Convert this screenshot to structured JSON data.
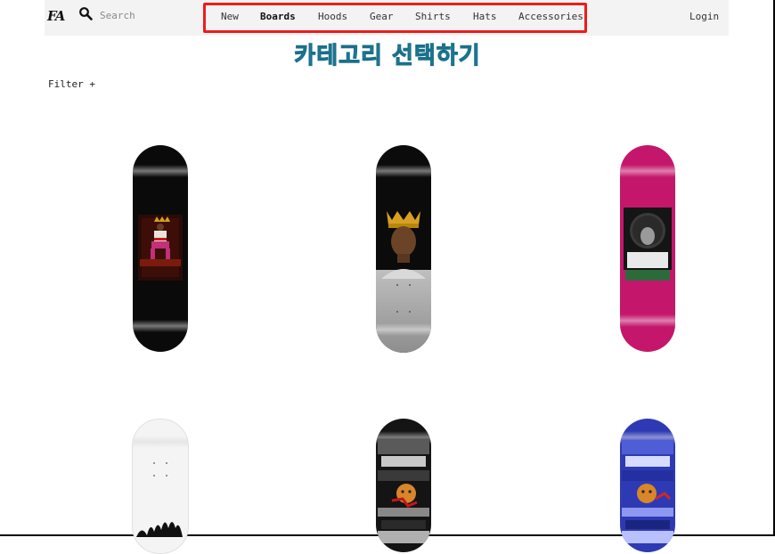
{
  "header": {
    "logo_text": "FA",
    "search_placeholder": "Search",
    "nav": [
      "New",
      "Boards",
      "Hoods",
      "Gear",
      "Shirts",
      "Hats",
      "Accessories"
    ],
    "active_nav": "Boards",
    "login_label": "Login",
    "highlight_color": "#ef1b1b"
  },
  "annotation": {
    "text": "카테고리 선택하기",
    "color": "#2fb6d6"
  },
  "filter": {
    "label": "Filter +"
  },
  "products": {
    "row1": [
      "black deck - throne graphic",
      "black/grey deck - crowned portrait",
      "magenta deck - afro portrait"
    ],
    "row2": [
      "white deck - dreadlocks portrait",
      "black deck - collage graphic",
      "blue deck - collage graphic"
    ]
  }
}
